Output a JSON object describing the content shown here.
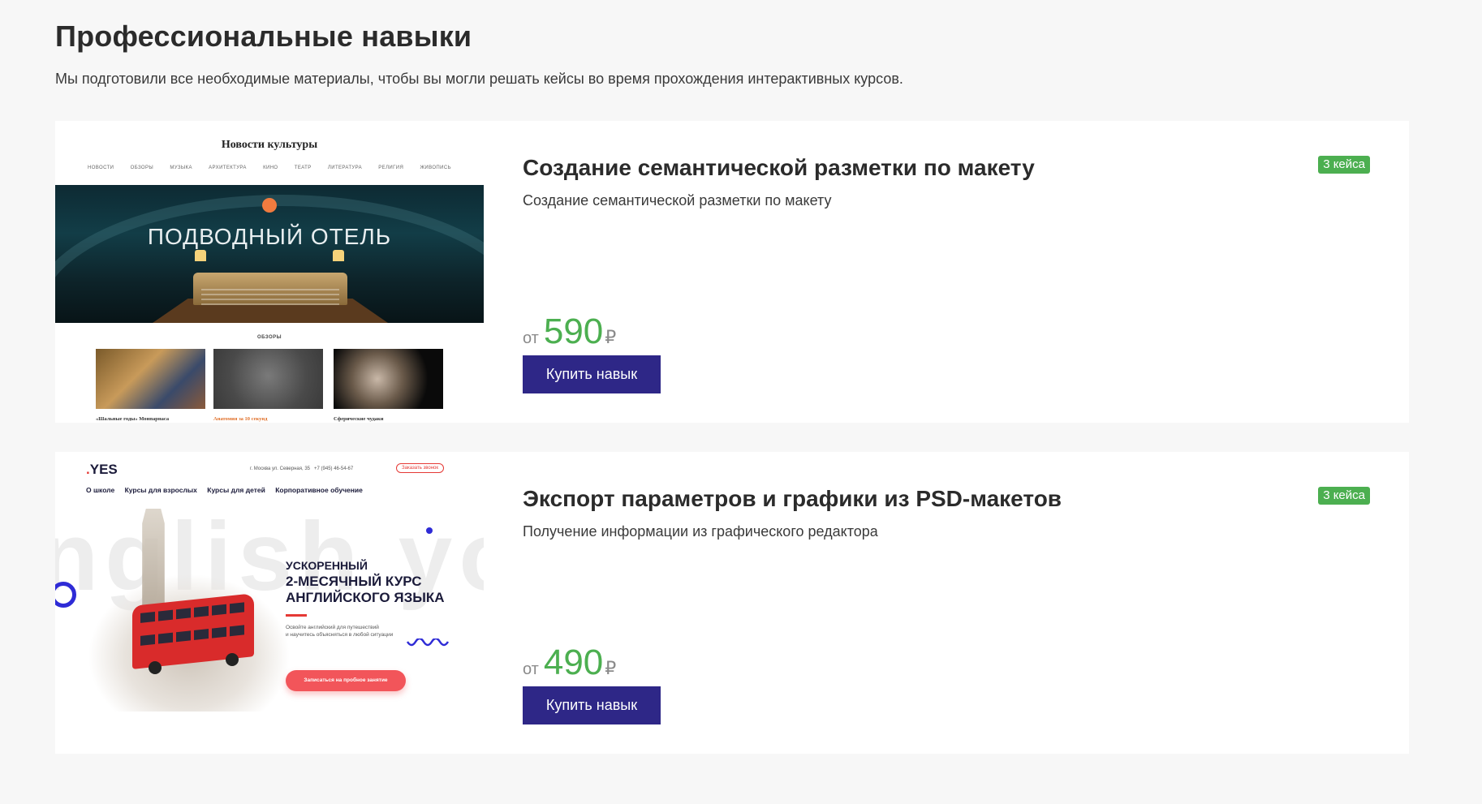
{
  "section": {
    "title": "Профессиональные навыки",
    "subtitle": "Мы подготовили все необходимые материалы, чтобы вы могли решать кейсы во время прохождения интерактивных курсов."
  },
  "colors": {
    "accent_green": "#4caf50",
    "button_bg": "#2e2787",
    "background": "#f7f7f7",
    "card_bg": "#ffffff"
  },
  "skills": [
    {
      "title": "Создание семантической разметки по макету",
      "description": "Создание семантической разметки по макету",
      "badge": "3 кейса",
      "price_prefix": "от",
      "price_value": "590",
      "currency": "₽",
      "button_label": "Купить навык",
      "thumbnail": {
        "site_logo": "Новости культуры",
        "nav": [
          "НОВОСТИ",
          "ОБЗОРЫ",
          "МУЗЫКА",
          "АРХИТЕКТУРА",
          "КИНО",
          "ТЕАТР",
          "ЛИТЕРАТУРА",
          "РЕЛИГИЯ",
          "ЖИВОПИСЬ"
        ],
        "hero_title": "ПОДВОДНЫЙ ОТЕЛЬ",
        "section_label": "ОБЗОРЫ",
        "captions": [
          "«Шальные годы» Монпарнаса",
          "Анатомия за 10 секунд",
          "Сферические чудаки"
        ]
      }
    },
    {
      "title": "Экспорт параметров и графики из PSD-макетов",
      "description": "Получение информации из графического редактора",
      "badge": "3 кейса",
      "price_prefix": "от",
      "price_value": "490",
      "currency": "₽",
      "button_label": "Купить навык",
      "thumbnail": {
        "logo_dot": ".",
        "logo_text": "YES",
        "address": "г. Москва ул. Северная, 35",
        "phone": "+7 (945) 46-54-67",
        "callback": "Заказать звонок",
        "nav": [
          "О школе",
          "Курсы для взрослых",
          "Курсы для детей",
          "Корпоративное обучение"
        ],
        "bg_word": "nglish yo",
        "headline_1": "УСКОРЕННЫЙ",
        "headline_2": "2-МЕСЯЧНЫЙ КУРС",
        "headline_3": "АНГЛИЙСКОГО ЯЗЫКА",
        "small_1": "Освойте английский для путешествий",
        "small_2": "и научитесь объясняться в любой ситуации",
        "cta": "Записаться на пробное занятие"
      }
    }
  ]
}
